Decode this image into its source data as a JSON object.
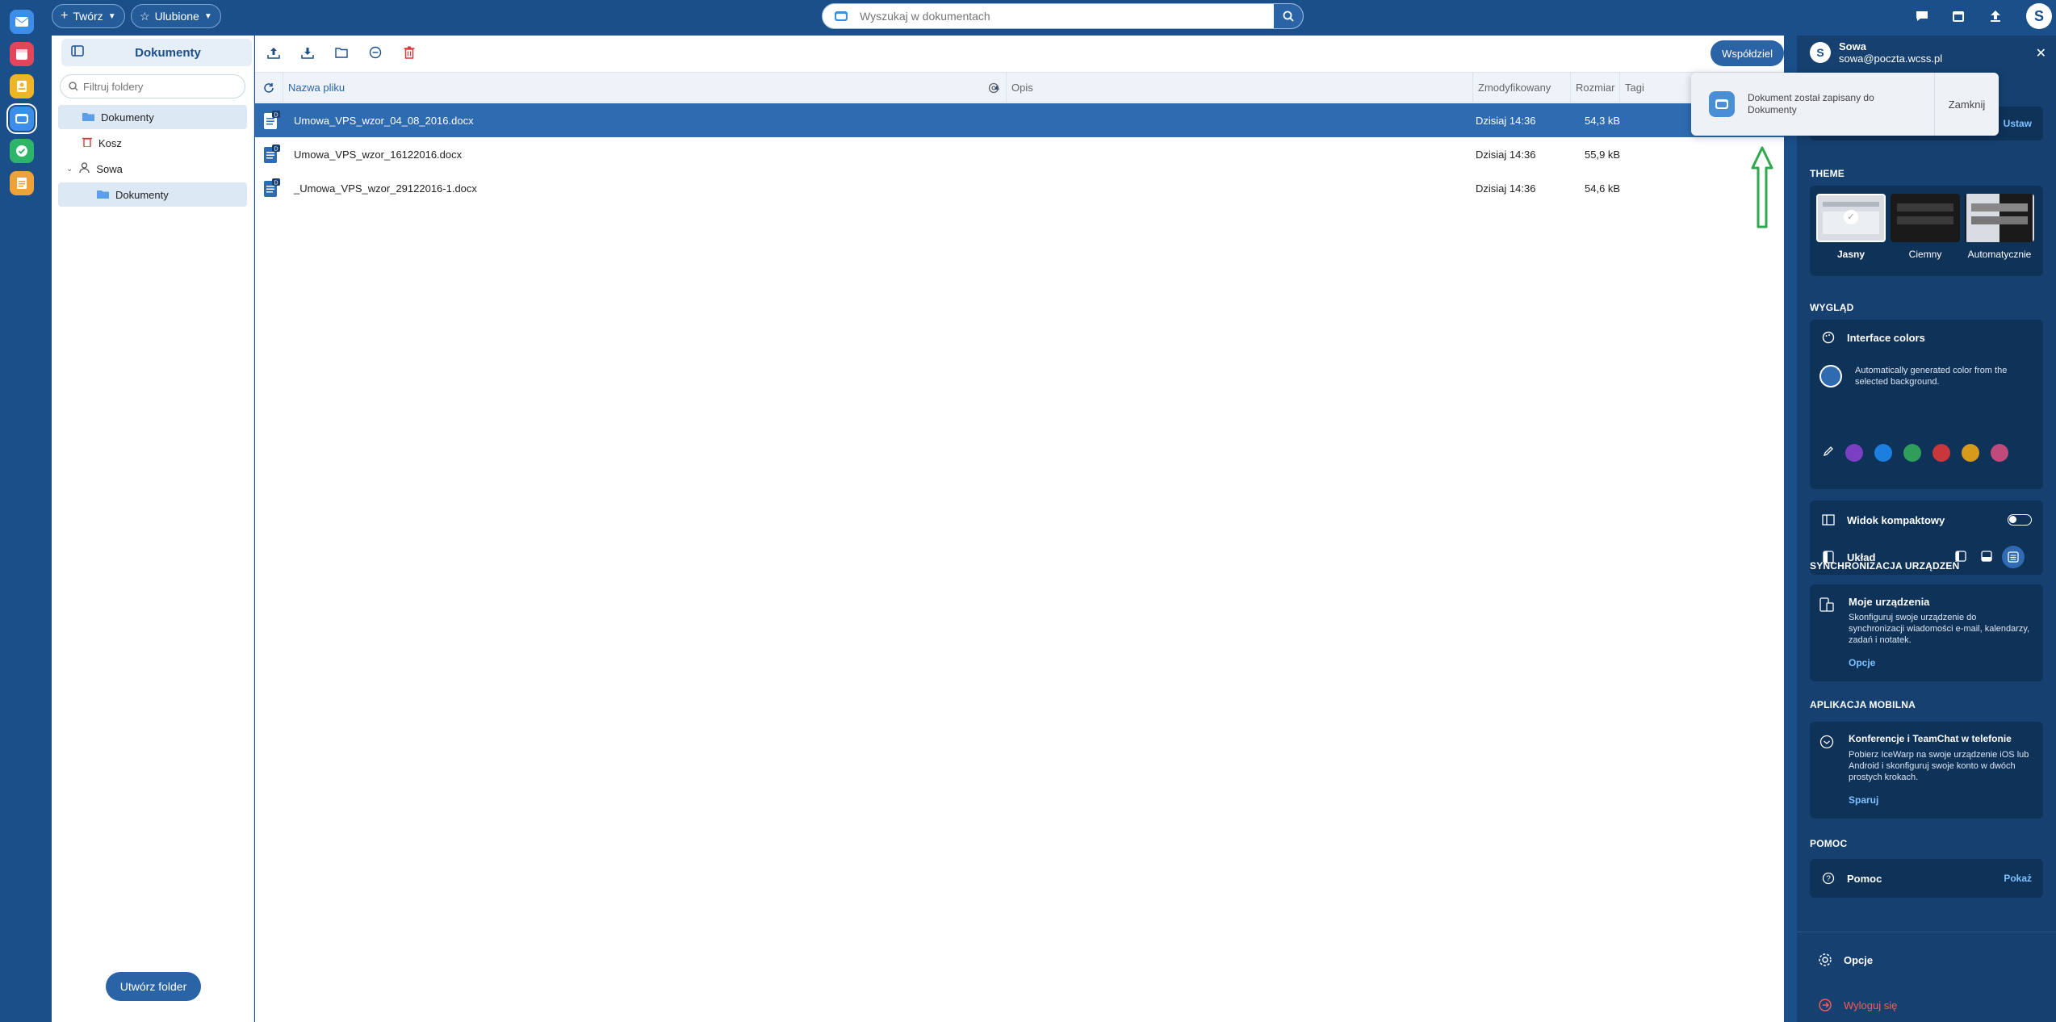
{
  "topbar": {
    "create_label": "Twórz",
    "favorites_label": "Ulubione",
    "search_placeholder": "Wyszukaj w dokumentach",
    "avatar_letter": "S"
  },
  "sidebar": {
    "title": "Dokumenty",
    "filter_placeholder": "Filtruj foldery",
    "items": [
      {
        "label": "Dokumenty"
      },
      {
        "label": "Kosz"
      },
      {
        "label": "Sowa"
      },
      {
        "label": "Dokumenty"
      }
    ],
    "create_folder_label": "Utwórz folder"
  },
  "main": {
    "share_label": "Współdziel",
    "columns": {
      "name": "Nazwa pliku",
      "desc": "Opis",
      "modified": "Zmodyfikowany",
      "size": "Rozmiar",
      "tags": "Tagi"
    },
    "files": [
      {
        "name": "Umowa_VPS_wzor_04_08_2016.docx",
        "modified": "Dzisiaj 14:36",
        "size": "54,3 kB"
      },
      {
        "name": "Umowa_VPS_wzor_16122016.docx",
        "modified": "Dzisiaj 14:36",
        "size": "55,9 kB"
      },
      {
        "name": "_Umowa_VPS_wzor_29122016-1.docx",
        "modified": "Dzisiaj 14:36",
        "size": "54,6 kB"
      }
    ]
  },
  "toast": {
    "message_line1": "Dokument został zapisany do",
    "message_line2": "Dokumenty",
    "close_label": "Zamknij"
  },
  "panel": {
    "user_name": "Sowa",
    "user_email": "sowa@poczta.wcss.pl",
    "hidden_link": "Ustaw",
    "theme_heading": "THEME",
    "themes": [
      "Jasny",
      "Ciemny",
      "Automatycznie"
    ],
    "look_heading": "WYGLĄD",
    "interface_colors": "Interface colors",
    "auto_color_text": "Automatically generated color from the selected background.",
    "palette": [
      "#7b3fc4",
      "#1c7fe0",
      "#2f9e5b",
      "#c8373c",
      "#d89a1a",
      "#c04a7c"
    ],
    "compact_view": "Widok kompaktowy",
    "layout": "Układ",
    "sync_heading": "SYNCHRONIZACJA URZĄDZEŃ",
    "my_devices": "Moje urządzenia",
    "my_devices_desc": "Skonfiguruj swoje urządzenie do synchronizacji wiadomości e-mail, kalendarzy, zadań i notatek.",
    "options_link": "Opcje",
    "mobile_heading": "APLIKACJA MOBILNA",
    "mobile_title": "Konferencje i TeamChat w telefonie",
    "mobile_desc": "Pobierz IceWarp na swoje urządzenie iOS lub Android i skonfiguruj swoje konto w dwóch prostych krokach.",
    "pair_link": "Sparuj",
    "help_heading": "POMOC",
    "help_label": "Pomoc",
    "help_link": "Pokaż",
    "options_label": "Opcje",
    "logout_label": "Wyloguj się"
  },
  "colors": {
    "brand": "#1b4f8a",
    "selected_row": "#2e6bb0",
    "annotation_arrow": "#2fa84f"
  }
}
